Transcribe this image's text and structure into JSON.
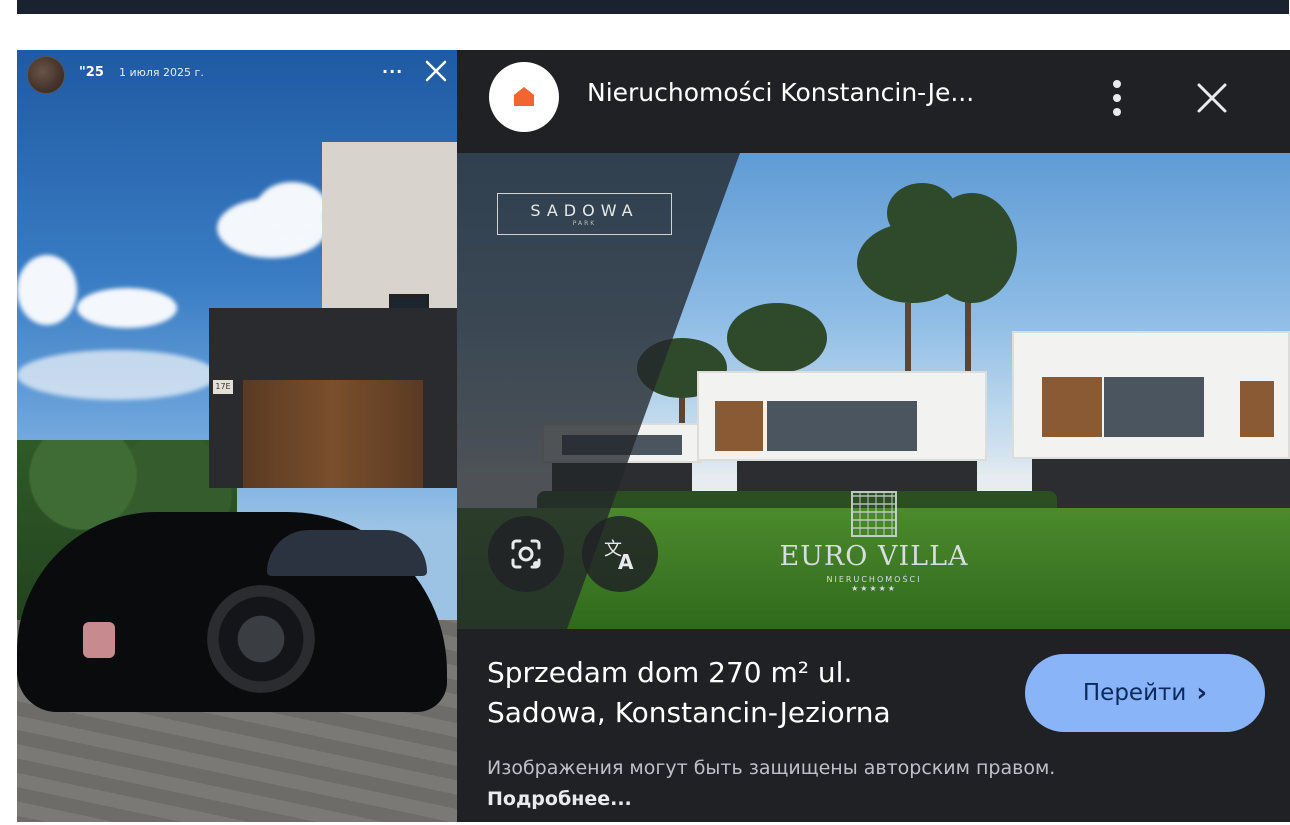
{
  "story": {
    "username": "\"25",
    "date": "1 июля 2025 г.",
    "more_label": "···",
    "house_number": "17E"
  },
  "lens": {
    "site_title": "Nieruchomości Konstancin-Je...",
    "sadowa_logo": "SADOWA",
    "sadowa_sub": "PARK",
    "eurovilla_name": "EURO VILLA",
    "eurovilla_sub": "NIERUCHOMOŚCI",
    "eurovilla_stars": "★★★★★",
    "ad_title_line1": "Sprzedam dom 270 m² ul.",
    "ad_title_line2": "Sadowa, Konstancin-Jeziorna",
    "cta_label": "Перейти",
    "cta_chevron": "›",
    "copyright_note": "Изображения могут быть защищены авторским правом.",
    "copyright_more": "Подробнее..."
  },
  "colors": {
    "topbar": "#19222e",
    "lens_bg": "#202124",
    "cta_bg": "#8ab4f8",
    "site_logo_accent": "#f26430"
  },
  "icons": [
    "avatar",
    "more-icon",
    "close-icon",
    "home-logo-icon",
    "kebab-menu-icon",
    "lens-search-icon",
    "translate-icon",
    "chevron-right-icon"
  ]
}
